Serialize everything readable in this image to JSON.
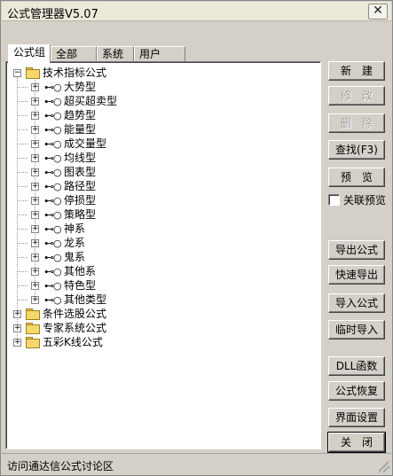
{
  "window": {
    "title": "公式管理器V5.07",
    "close_glyph": "✕"
  },
  "tabs": [
    {
      "label": "公式组",
      "active": true
    },
    {
      "label": "全部",
      "active": false
    },
    {
      "label": "系统",
      "active": false
    },
    {
      "label": "用户",
      "active": false
    }
  ],
  "tree": {
    "root": {
      "label": "技术指标公式",
      "expanded": true,
      "expander": "−"
    },
    "children": [
      {
        "label": "大势型",
        "expander": "+"
      },
      {
        "label": "超买超卖型",
        "expander": "+"
      },
      {
        "label": "趋势型",
        "expander": "+"
      },
      {
        "label": "能量型",
        "expander": "+"
      },
      {
        "label": "成交量型",
        "expander": "+"
      },
      {
        "label": "均线型",
        "expander": "+"
      },
      {
        "label": "图表型",
        "expander": "+"
      },
      {
        "label": "路径型",
        "expander": "+"
      },
      {
        "label": "停损型",
        "expander": "+"
      },
      {
        "label": "策略型",
        "expander": "+"
      },
      {
        "label": "神系",
        "expander": "+"
      },
      {
        "label": "龙系",
        "expander": "+"
      },
      {
        "label": "鬼系",
        "expander": "+"
      },
      {
        "label": "其他系",
        "expander": "+"
      },
      {
        "label": "特色型",
        "expander": "+"
      },
      {
        "label": "其他类型",
        "expander": "+"
      }
    ],
    "others": [
      {
        "label": "条件选股公式",
        "expander": "+"
      },
      {
        "label": "专家系统公式",
        "expander": "+"
      },
      {
        "label": "五彩K线公式",
        "expander": "+"
      }
    ],
    "key_glyph": "⊷○"
  },
  "buttons": {
    "new": "新　建",
    "edit": "修　改",
    "delete": "删　除",
    "find": "查找(F3)",
    "preview": "预　览",
    "export": "导出公式",
    "quick_export": "快速导出",
    "import": "导入公式",
    "temp_import": "临时导入",
    "dll": "DLL函数",
    "restore": "公式恢复",
    "ui_settings": "界面设置",
    "close": "关　闭"
  },
  "link_preview": {
    "label": "关联预览",
    "checked": false
  },
  "status": {
    "text": "访问通达信公式讨论区"
  }
}
